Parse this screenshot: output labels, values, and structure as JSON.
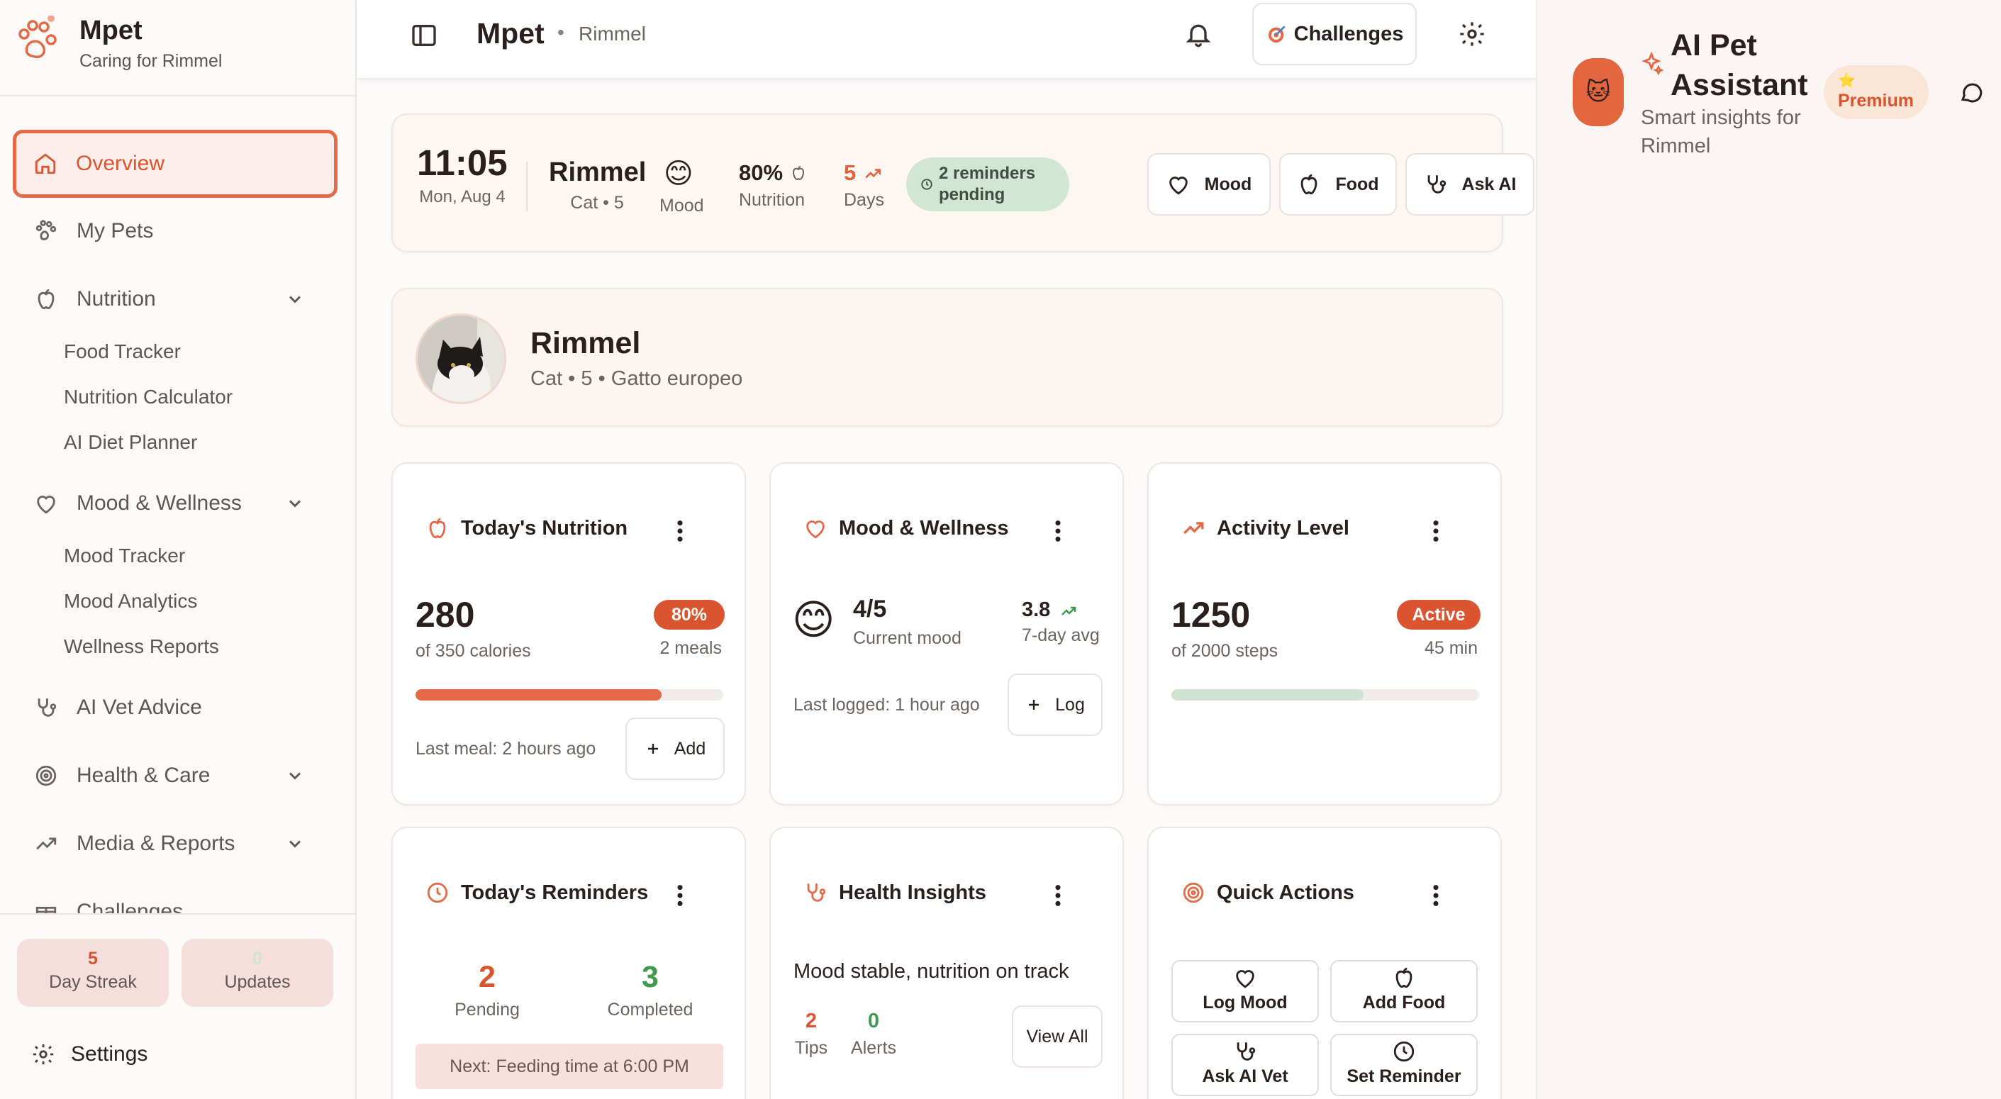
{
  "brand": {
    "name": "Mpet",
    "subtitle": "Caring for Rimmel"
  },
  "sidebar": {
    "items": [
      {
        "label": "Overview"
      },
      {
        "label": "My Pets"
      },
      {
        "label": "Nutrition"
      },
      {
        "label": "Mood & Wellness"
      },
      {
        "label": "AI Vet Advice"
      },
      {
        "label": "Health & Care"
      },
      {
        "label": "Media & Reports"
      },
      {
        "label": "Challenges"
      }
    ],
    "nutrition_sub": [
      "Food Tracker",
      "Nutrition Calculator",
      "AI Diet Planner"
    ],
    "mood_sub": [
      "Mood Tracker",
      "Mood Analytics",
      "Wellness Reports"
    ],
    "streak": {
      "value": "5",
      "label": "Day Streak"
    },
    "updates": {
      "value": "0",
      "label": "Updates"
    },
    "settings_label": "Settings"
  },
  "header": {
    "title": "Mpet",
    "separator": "•",
    "breadcrumb": "Rimmel",
    "challenges_label": "Challenges"
  },
  "status": {
    "time": "11:05",
    "date": "Mon, Aug 4",
    "pet_name": "Rimmel",
    "pet_meta": "Cat • 5",
    "mood_emoji": "😊",
    "mood_label": "Mood",
    "nutrition_value": "80%",
    "nutrition_label": "Nutrition",
    "days_value": "5",
    "days_label": "Days",
    "reminders_badge": "2 reminders pending",
    "quick": {
      "mood": "Mood",
      "food": "Food",
      "ask": "Ask AI"
    }
  },
  "profile": {
    "name": "Rimmel",
    "details": "Cat • 5 • Gatto europeo"
  },
  "widgets": {
    "nutrition": {
      "title": "Today's Nutrition",
      "calories": "280",
      "calories_of": "of 350 calories",
      "percent": "80%",
      "meals": "2 meals",
      "progress": 0.8,
      "last": "Last meal: 2 hours ago",
      "add_label": "Add"
    },
    "mood": {
      "title": "Mood & Wellness",
      "emoji": "😊",
      "score": "4/5",
      "score_label": "Current mood",
      "avg": "3.8",
      "avg_label": "7-day avg",
      "last": "Last logged: 1 hour ago",
      "log_label": "Log"
    },
    "activity": {
      "title": "Activity Level",
      "steps": "1250",
      "steps_of": "of 2000 steps",
      "status": "Active",
      "minutes": "45 min",
      "progress": 0.625
    },
    "reminders": {
      "title": "Today's Reminders",
      "pending": "2",
      "pending_label": "Pending",
      "completed": "3",
      "completed_label": "Completed",
      "next": "Next: Feeding time at 6:00 PM"
    },
    "insights": {
      "title": "Health Insights",
      "summary": "Mood stable, nutrition on track",
      "tips": "2",
      "tips_label": "Tips",
      "alerts": "0",
      "alerts_label": "Alerts",
      "view_label": "View All"
    },
    "quick_actions": {
      "title": "Quick Actions",
      "log_mood": "Log Mood",
      "add_food": "Add Food",
      "ask_vet": "Ask AI Vet",
      "set_reminder": "Set Reminder"
    }
  },
  "assistant": {
    "title": "AI Pet Assistant",
    "subtitle": "Smart insights for Rimmel",
    "premium_star": "⭐",
    "premium_label": "Premium",
    "avatar_emoji": "🐱"
  },
  "colors": {
    "accent": "#e36a47",
    "accent_dark": "#d9542f",
    "success": "#3f9a4f",
    "track_green": "#cfe3d3"
  }
}
